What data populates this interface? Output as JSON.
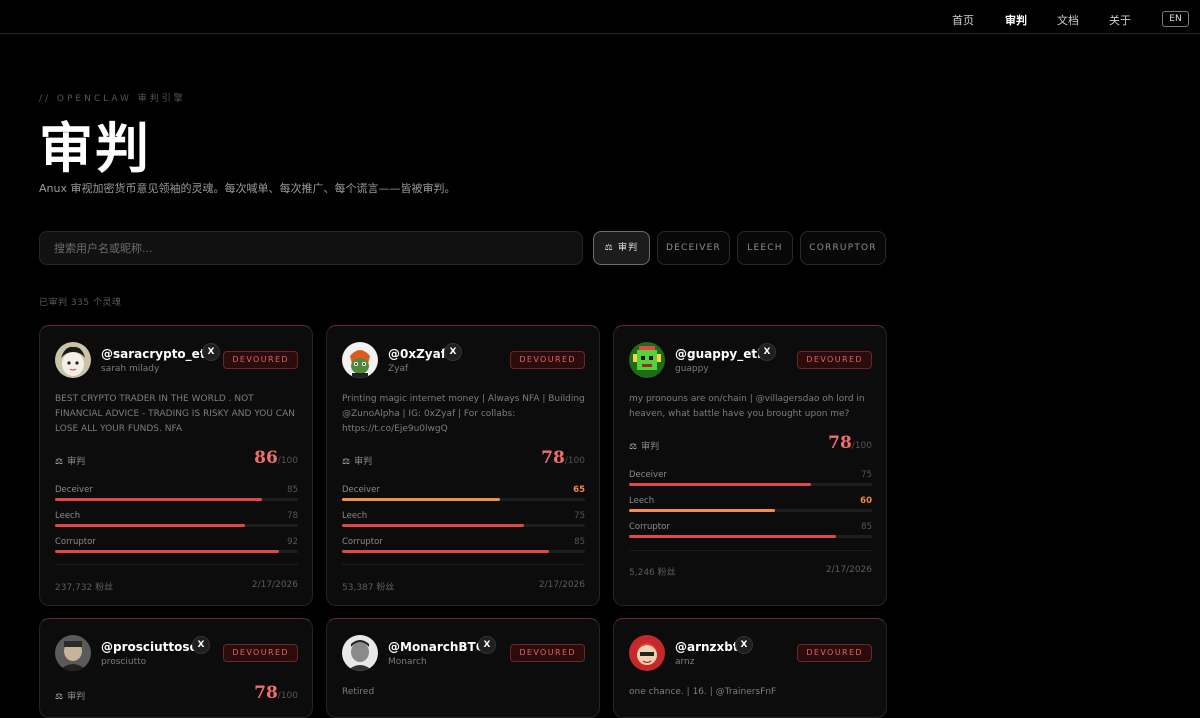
{
  "nav": {
    "items": [
      {
        "label": "首页",
        "active": false
      },
      {
        "label": "审判",
        "active": true
      },
      {
        "label": "文档",
        "active": false
      },
      {
        "label": "关于",
        "active": false
      }
    ],
    "lang": "EN"
  },
  "hero": {
    "eyebrow": "// OPENCLAW 审判引擎",
    "title": "审判",
    "subtitle": "Anux 审视加密货币意见领袖的灵魂。每次喊单、每次推广、每个谎言——皆被审判。"
  },
  "search": {
    "placeholder": "搜索用户名或昵称..."
  },
  "filters": [
    {
      "label": "审判",
      "icon": "gavel-icon",
      "active": true
    },
    {
      "label": "DECEIVER",
      "active": false
    },
    {
      "label": "LEECH",
      "active": false
    },
    {
      "label": "CORRUPTOR",
      "active": false
    }
  ],
  "summary": {
    "count_text": "已审判 335 个灵魂"
  },
  "labels": {
    "judge": "审判",
    "score_suffix": "/100",
    "x_glyph": "X"
  },
  "colors": {
    "red": "#e04848",
    "orange": "#f0904a",
    "score": "#f07070"
  },
  "cards": [
    {
      "handle": "@saracrypto_eth",
      "display_name": "sarah milady",
      "status": "DEVOURED",
      "bio": "BEST CRYPTO TRADER IN THE WORLD . NOT FINANCIAL ADVICE - TRADING IS RISKY AND YOU CAN LOSE ALL YOUR FUNDS. NFA",
      "score": "86",
      "metrics": [
        {
          "name": "Deceiver",
          "value": "85",
          "highlight": false
        },
        {
          "name": "Leech",
          "value": "78",
          "highlight": false
        },
        {
          "name": "Corruptor",
          "value": "92",
          "highlight": false
        }
      ],
      "followers": "237,732 粉丝",
      "date": "2/17/2026",
      "avatar": "anime-avatar"
    },
    {
      "handle": "@0xZyaf",
      "display_name": "Zyaf",
      "status": "DEVOURED",
      "bio": "Printing magic internet money | Always NFA | Building @ZunoAlpha | IG: 0xZyaf | For collabs: https://t.co/Eje9u0lwgQ",
      "score": "78",
      "metrics": [
        {
          "name": "Deceiver",
          "value": "65",
          "highlight": true
        },
        {
          "name": "Leech",
          "value": "75",
          "highlight": false
        },
        {
          "name": "Corruptor",
          "value": "85",
          "highlight": false
        }
      ],
      "followers": "53,387 粉丝",
      "date": "2/17/2026",
      "avatar": "goblin-avatar"
    },
    {
      "handle": "@guappy_eth",
      "display_name": "guappy",
      "status": "DEVOURED",
      "bio": "my pronouns are on/chain | @villagersdao oh lord in heaven, what battle have you brought upon me?",
      "score": "78",
      "metrics": [
        {
          "name": "Deceiver",
          "value": "75",
          "highlight": false
        },
        {
          "name": "Leech",
          "value": "60",
          "highlight": true
        },
        {
          "name": "Corruptor",
          "value": "85",
          "highlight": false
        }
      ],
      "followers": "5,246 粉丝",
      "date": "2/17/2026",
      "avatar": "green-pixel-avatar"
    },
    {
      "handle": "@prosciuttosol",
      "display_name": "prosciutto",
      "status": "DEVOURED",
      "bio": "",
      "score": "78",
      "metrics": [],
      "followers": "",
      "date": "",
      "avatar": "photo-avatar"
    },
    {
      "handle": "@MonarchBTC",
      "display_name": "Monarch",
      "status": "DEVOURED",
      "bio": "Retired",
      "score": "",
      "metrics": [],
      "followers": "",
      "date": "",
      "avatar": "bw-portrait-avatar"
    },
    {
      "handle": "@arnzxbt",
      "display_name": "arnz",
      "status": "DEVOURED",
      "bio": "one chance. | 16. | @TrainersFnF",
      "score": "",
      "metrics": [],
      "followers": "",
      "date": "",
      "avatar": "red-anime-avatar"
    }
  ]
}
